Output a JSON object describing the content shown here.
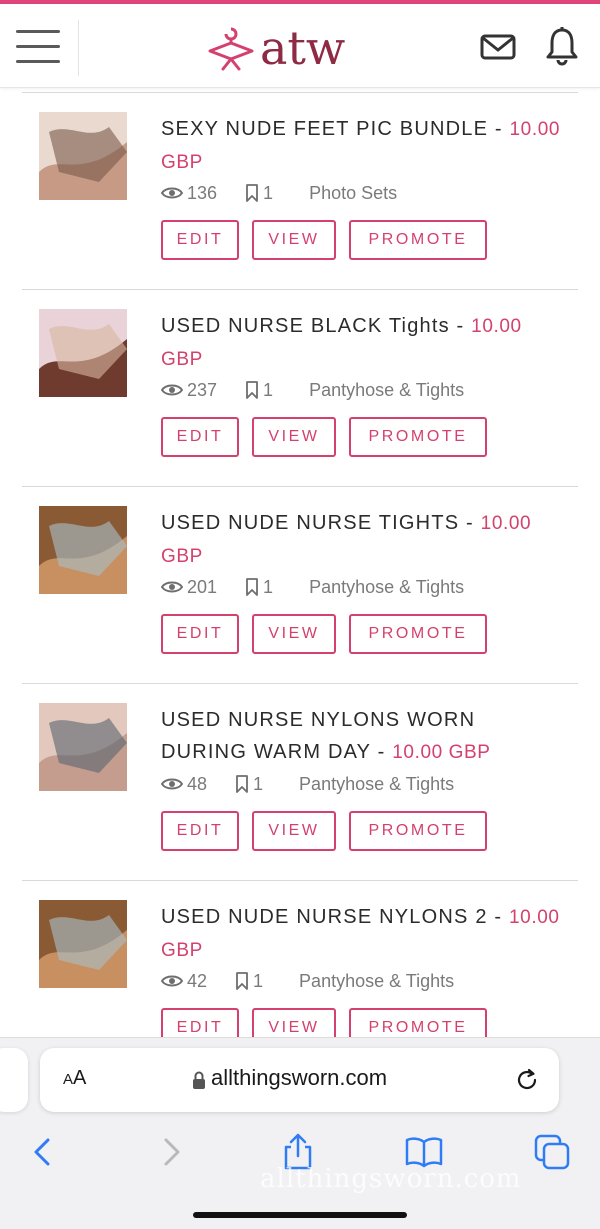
{
  "brand": {
    "name": "atw",
    "accent": "#d4416e",
    "logo_color": "#8f2a45"
  },
  "header": {
    "menu_icon": "hamburger-icon",
    "mail_icon": "mail-icon",
    "bell_icon": "bell-icon"
  },
  "listings": [
    {
      "title": "SEXY NUDE FEET PIC BUNDLE - ",
      "price": "10.00 GBP",
      "views": "136",
      "saves": "1",
      "category": "Photo Sets"
    },
    {
      "title": "USED NURSE BLACK Tights - ",
      "price": "10.00 GBP",
      "views": "237",
      "saves": "1",
      "category": "Pantyhose & Tights"
    },
    {
      "title": "USED NUDE NURSE TIGHTS - ",
      "price": "10.00 GBP",
      "views": "201",
      "saves": "1",
      "category": "Pantyhose & Tights"
    },
    {
      "title": "USED NURSE NYLONS WORN DURING WARM DAY - ",
      "price": "10.00 GBP",
      "views": "48",
      "saves": "1",
      "category": "Pantyhose & Tights"
    },
    {
      "title": "USED NUDE NURSE NYLONS 2 - ",
      "price": "10.00 GBP",
      "views": "42",
      "saves": "1",
      "category": "Pantyhose & Tights"
    }
  ],
  "actions": {
    "edit": "EDIT",
    "view": "VIEW",
    "promote": "PROMOTE"
  },
  "browser": {
    "text_size_label_small": "A",
    "text_size_label_large": "A",
    "url": "allthingsworn.com",
    "watermark": "allthingsworn.com"
  }
}
